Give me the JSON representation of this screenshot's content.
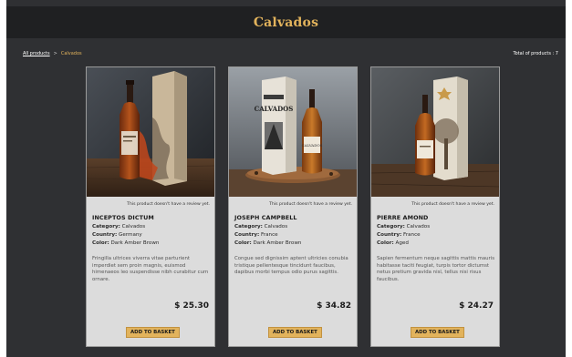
{
  "header": {
    "title": "Calvados"
  },
  "breadcrumb": {
    "root": "All products",
    "separator": ">",
    "current": "Calvados"
  },
  "summary": {
    "total": "Total of products : 7"
  },
  "labels": {
    "category": "Category:",
    "country": "Country:",
    "color": "Color:",
    "review": "This product doesn't have a review yet.",
    "add_to_basket": "ADD TO BASKET"
  },
  "products": [
    {
      "name": "INCEPTOS DICTUM",
      "category": "Calvados",
      "country": "Germany",
      "color": "Dark Amber Brown",
      "description": "Fringilla ultrices viverra vitae parturient imperdiet sem proin magnis, euismod himenaeos leo suspendisse nibh curabitur cum ornare.",
      "price": "$ 25.30"
    },
    {
      "name": "JOSEPH CAMPBELL",
      "category": "Calvados",
      "country": "France",
      "color": "Dark Amber Brown",
      "description": "Congue sed dignissim aptent ultricies conubia tristique pellentesque tincidunt faucibus, dapibus morbi tempus odio purus sagittis.",
      "price": "$ 34.82",
      "box_text": "CALVADOS"
    },
    {
      "name": "PIERRE AMOND",
      "category": "Calvados",
      "country": "France",
      "color": "Aged",
      "description": "Sapien fermentum neque sagittis mattis mauris habitasse taciti feugiat, turpis tortor dictumst netus pretium gravida nisl, tellus nisi risus faucibus.",
      "price": "$ 24.27"
    }
  ],
  "colors": {
    "accent": "#e2b35c",
    "background": "#2f3033",
    "header": "#1f2022",
    "card": "#dcdcdc"
  }
}
